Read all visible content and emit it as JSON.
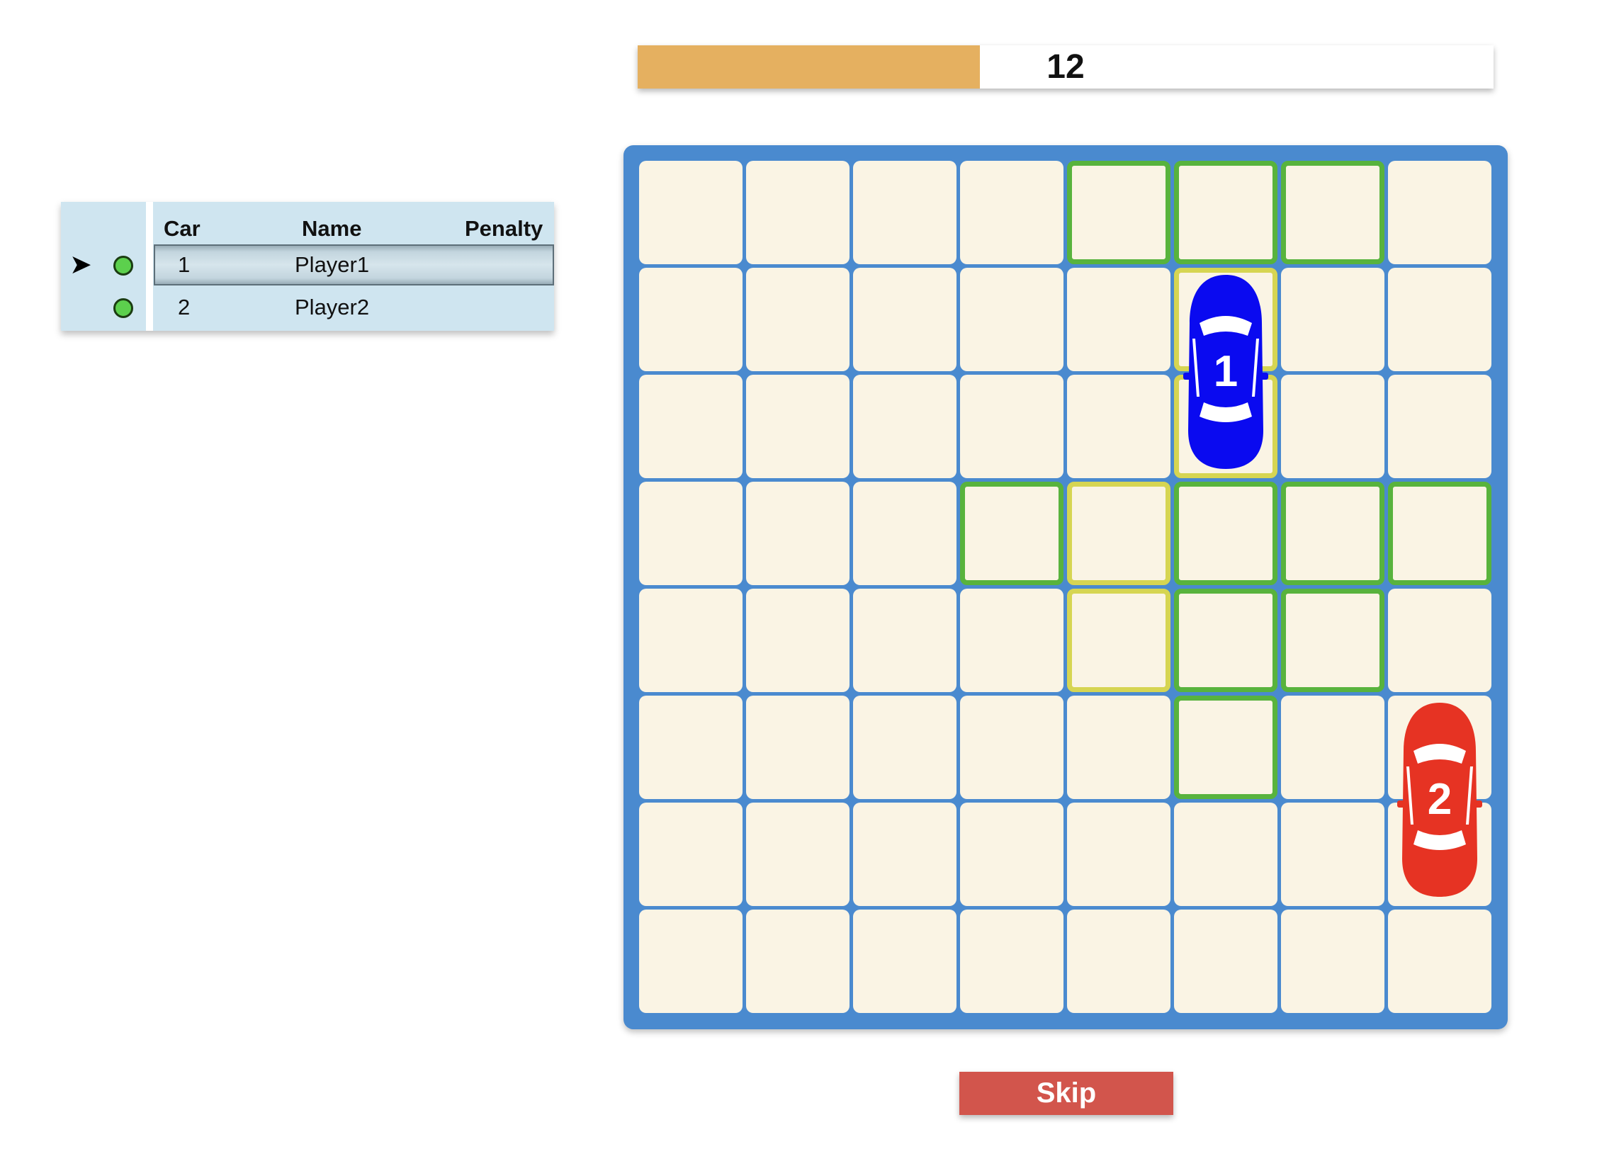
{
  "timer": {
    "remaining": "12",
    "fill_fraction": 0.4
  },
  "players_table": {
    "headers": {
      "car": "Car",
      "name": "Name",
      "penalty": "Penalty"
    },
    "rows": [
      {
        "car": "1",
        "name": "Player1",
        "penalty": "",
        "status": "online",
        "current_turn": true
      },
      {
        "car": "2",
        "name": "Player2",
        "penalty": "",
        "status": "online",
        "current_turn": false
      }
    ],
    "turn_marker": "➤"
  },
  "board": {
    "rows": 8,
    "cols": 8,
    "green_cells": [
      [
        0,
        4
      ],
      [
        0,
        5
      ],
      [
        0,
        6
      ],
      [
        3,
        3
      ],
      [
        3,
        5
      ],
      [
        3,
        6
      ],
      [
        3,
        7
      ],
      [
        4,
        5
      ],
      [
        4,
        6
      ],
      [
        5,
        5
      ]
    ],
    "yellow_cells": [
      [
        1,
        5
      ],
      [
        2,
        5
      ],
      [
        3,
        4
      ],
      [
        4,
        4
      ]
    ],
    "cars": [
      {
        "number": "1",
        "color": "#0a0af0",
        "row": 1,
        "col": 5
      },
      {
        "number": "2",
        "color": "#e63323",
        "row": 5,
        "col": 7
      }
    ]
  },
  "colors": {
    "board_frame": "#4a8acf",
    "cell": "#faf4e4",
    "highlight_green": "#58b33d",
    "highlight_yellow": "#d6d552",
    "timer_fill": "#e5b060",
    "skip_button": "#d2554c"
  },
  "actions": {
    "skip_label": "Skip"
  }
}
